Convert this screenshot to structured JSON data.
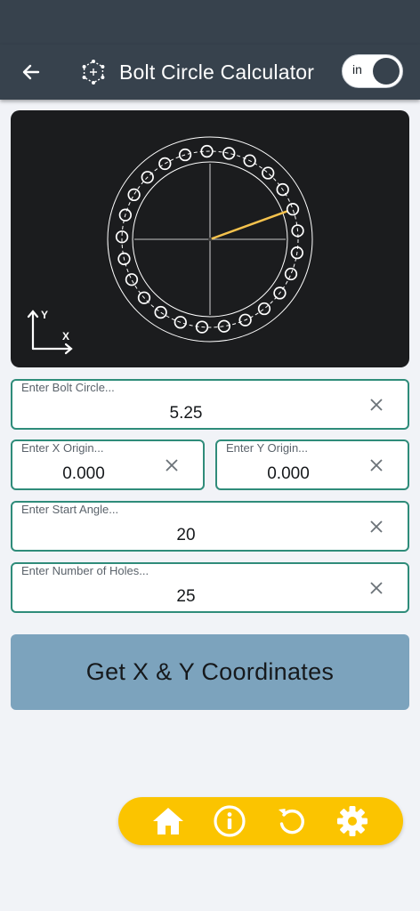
{
  "header": {
    "title": "Bolt Circle Calculator",
    "toggle_label": "in",
    "back_icon": "arrow-left-icon",
    "title_icon": "bolt-circle-icon"
  },
  "diagram": {
    "hole_count": 25,
    "start_angle_deg": 20,
    "axis_labels": {
      "x": "X",
      "y": "Y"
    },
    "colors": {
      "background": "#1b1c1e",
      "lines": "#ffffff",
      "angle_line": "#f5c24d"
    }
  },
  "fields": {
    "bolt_circle": {
      "label": "Enter Bolt Circle...",
      "value": "5.25"
    },
    "x_origin": {
      "label": "Enter X Origin...",
      "value": "0.000"
    },
    "y_origin": {
      "label": "Enter Y Origin...",
      "value": "0.000"
    },
    "start_angle": {
      "label": "Enter Start Angle...",
      "value": "20"
    },
    "num_holes": {
      "label": "Enter Number of Holes...",
      "value": "25"
    }
  },
  "actions": {
    "calculate_label": "Get X & Y Coordinates"
  },
  "bottom_nav": {
    "items": [
      {
        "name": "home",
        "icon": "home-icon"
      },
      {
        "name": "info",
        "icon": "info-icon"
      },
      {
        "name": "reset",
        "icon": "reset-icon"
      },
      {
        "name": "settings",
        "icon": "gear-icon"
      }
    ]
  },
  "colors": {
    "app_bar": "#37424d",
    "field_border": "#2f8c7a",
    "button": "#7ca3bd",
    "nav": "#fbc400"
  }
}
